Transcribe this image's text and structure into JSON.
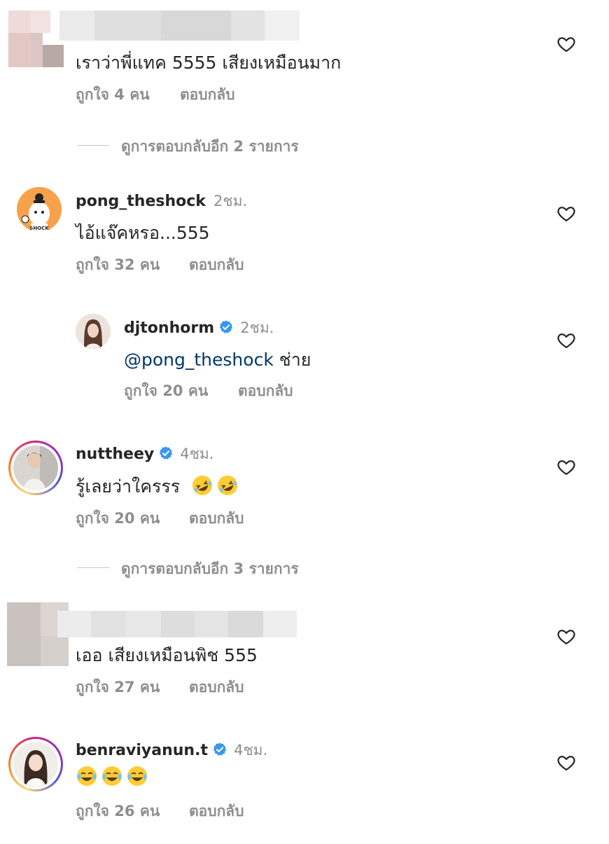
{
  "colors": {
    "heart": "#262626",
    "verified": "#3897f0",
    "mention": "#00376b",
    "meta": "#8e8e8e"
  },
  "comments": [
    {
      "username": "",
      "text": "เราว่าพี่แทค 5555 เสียงเหมือนมาก",
      "likes": "ถูกใจ 4 คน",
      "reply": "ตอบกลับ"
    },
    {
      "more_replies": "ดูการตอบกลับอีก 2 รายการ"
    },
    {
      "username": "pong_theshock",
      "time": "2ชม.",
      "text": "ไอ้แจ๊คหรอ...555",
      "likes": "ถูกใจ 32 คน",
      "reply": "ตอบกลับ"
    },
    {
      "username": "djtonhorm",
      "time": "2ชม.",
      "mention": "@pong_theshock",
      "text": " ช่าย",
      "likes": "ถูกใจ 20 คน",
      "reply": "ตอบกลับ"
    },
    {
      "username": "nuttheey",
      "time": "4ชม.",
      "text": "รู้เลยว่าใครรร",
      "emoji": "rolling-on-floor-laughing",
      "likes": "ถูกใจ 20 คน",
      "reply": "ตอบกลับ"
    },
    {
      "more_replies": "ดูการตอบกลับอีก 3 รายการ"
    },
    {
      "username": "",
      "text": "เออ เสียงเหมือนพิช 555",
      "likes": "ถูกใจ 27 คน",
      "reply": "ตอบกลับ"
    },
    {
      "username": "benraviyanun.t",
      "time": "4ชม.",
      "text": "",
      "emoji": "face-with-tears-of-joy",
      "likes": "ถูกใจ 26 คน",
      "reply": "ตอบกลับ"
    }
  ]
}
